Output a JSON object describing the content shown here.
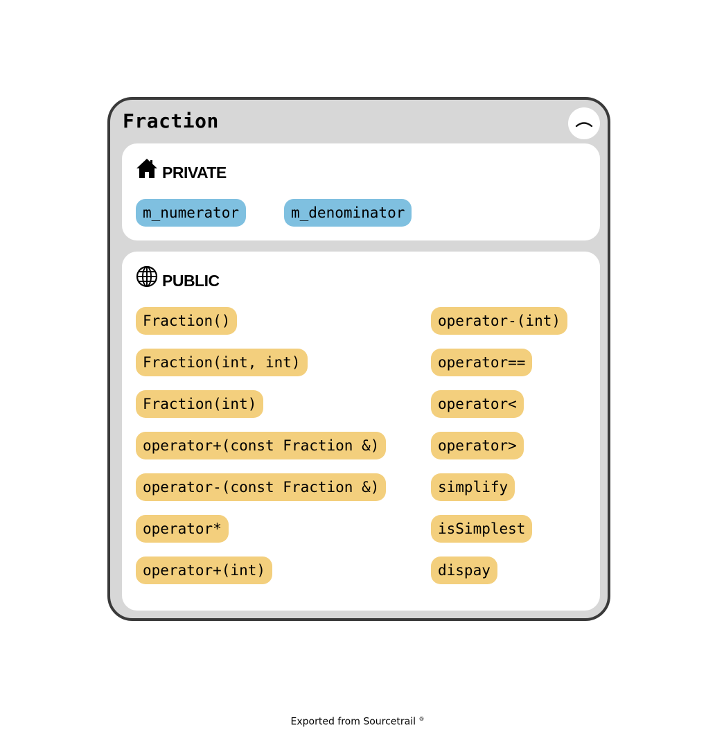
{
  "node": {
    "title": "Fraction",
    "collapse_icon": "chevron-up-icon"
  },
  "sections": {
    "private": {
      "label": "PRIVATE",
      "icon": "house-icon",
      "members": [
        "m_numerator",
        "m_denominator"
      ]
    },
    "public": {
      "label": "PUBLIC",
      "icon": "globe-icon",
      "members_left": [
        "Fraction()",
        "Fraction(int, int)",
        "Fraction(int)",
        "operator+(const Fraction &)",
        "operator-(const Fraction &)",
        "operator*",
        "operator+(int)"
      ],
      "members_right": [
        "operator-(int)",
        "operator==",
        "operator<",
        "operator>",
        "simplify",
        "isSimplest",
        "dispay"
      ]
    }
  },
  "colors": {
    "field": "#7fc0e0",
    "function": "#f3cf7d",
    "node_bg": "#d7d7d7",
    "node_border": "#3a3a3a"
  },
  "footer": {
    "text": "Exported from Sourcetrail",
    "mark": "®"
  }
}
